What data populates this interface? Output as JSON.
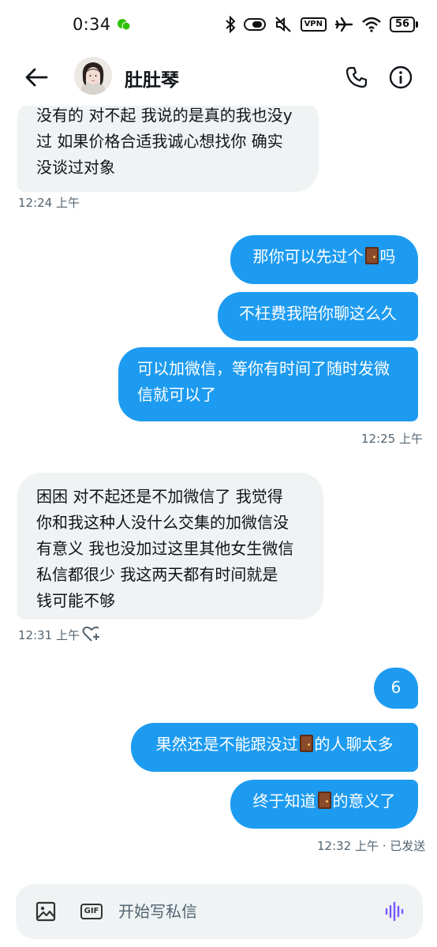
{
  "status_bar": {
    "time": "0:34",
    "battery": "56",
    "vpn": "VPN"
  },
  "header": {
    "contact_name": "肚肚琴",
    "icons": [
      "back-arrow-icon",
      "phone-icon",
      "info-icon"
    ]
  },
  "messages": [
    {
      "direction": "in",
      "text_lines": [
        "没有的 对不起 我说的是真的我也没y",
        "过 如果价格合适我诚心想找你 确实",
        "没谈过对象"
      ]
    },
    {
      "kind": "timestamp",
      "text": "12:24 上午"
    },
    {
      "direction": "out",
      "text_before": "那你可以先过个",
      "emoji": "door",
      "text_after": "吗"
    },
    {
      "direction": "out",
      "text": "不枉费我陪你聊这么久"
    },
    {
      "direction": "out",
      "text_lines": [
        "可以加微信，等你有时间了随时发微",
        "信就可以了"
      ]
    },
    {
      "kind": "timestamp",
      "text": "12:25 上午"
    },
    {
      "direction": "in",
      "text_lines": [
        "困困 对不起还是不加微信了 我觉得",
        "你和我这种人没什么交集的加微信没",
        "有意义 我也没加过这里其他女生微信",
        "私信都很少 我这两天都有时间就是",
        "钱可能不够"
      ]
    },
    {
      "kind": "timestamp",
      "text": "12:31 上午"
    },
    {
      "direction": "out",
      "text": "6"
    },
    {
      "direction": "out",
      "text_before": "果然还是不能跟没过",
      "emoji": "door",
      "text_after": "的人聊太多"
    },
    {
      "direction": "out",
      "text_before": "终于知道",
      "emoji": "door",
      "text_after": "的意义了"
    },
    {
      "kind": "timestamp",
      "text": "12:32 上午 · 已发送"
    }
  ],
  "composer": {
    "placeholder": "开始写私信",
    "gif_label": "GIF"
  }
}
